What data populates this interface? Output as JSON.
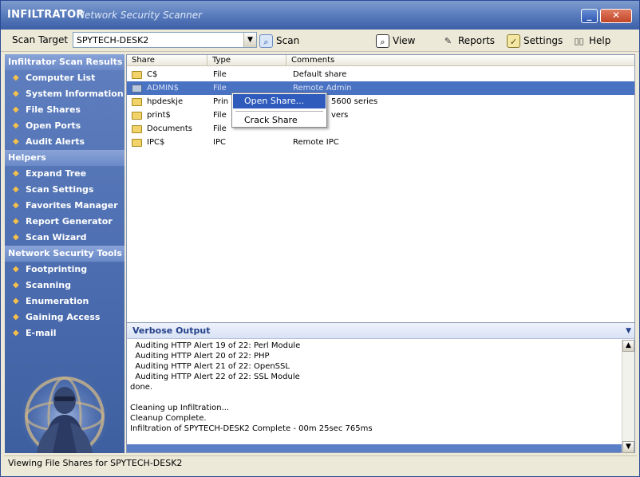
{
  "window": {
    "brand": "INFILTRATOR",
    "subtitle": "Network Security Scanner",
    "minimize_glyph": "_",
    "close_glyph": "✕"
  },
  "toolbar": {
    "scan_target_label": "Scan Target",
    "scan_target_value": "SPYTECH-DESK2",
    "scan_label": "Scan",
    "view_label": "View",
    "reports_label": "Reports",
    "settings_label": "Settings",
    "help_label": "Help"
  },
  "sidebar": {
    "sections": [
      {
        "title": "Infiltrator Scan Results",
        "items": [
          "Computer List",
          "System Information",
          "File Shares",
          "Open Ports",
          "Audit Alerts"
        ]
      },
      {
        "title": "Helpers",
        "items": [
          "Expand Tree",
          "Scan Settings",
          "Favorites Manager",
          "Report Generator",
          "Scan Wizard"
        ]
      },
      {
        "title": "Network Security Tools",
        "items": [
          "Footprinting",
          "Scanning",
          "Enumeration",
          "Gaining Access",
          "E-mail"
        ]
      }
    ]
  },
  "shares": {
    "columns": [
      "Share",
      "Type",
      "Comments"
    ],
    "rows": [
      {
        "share": "C$",
        "type": "File",
        "comment": "Default share",
        "shared_icon": false
      },
      {
        "share": "ADMIN$",
        "type": "File",
        "comment": "Remote Admin",
        "shared_icon": true
      },
      {
        "share": "hpdeskje",
        "type": "Prin",
        "comment": "5600 series",
        "shared_icon": false
      },
      {
        "share": "print$",
        "type": "File",
        "comment": "vers",
        "shared_icon": false
      },
      {
        "share": "Documents",
        "type": "File",
        "comment": "",
        "shared_icon": false
      },
      {
        "share": "IPC$",
        "type": "IPC",
        "comment": "Remote IPC",
        "shared_icon": false
      }
    ],
    "selected_index": 1
  },
  "context_menu": {
    "items": [
      "Open Share...",
      "Crack Share"
    ]
  },
  "verbose": {
    "title": "Verbose Output",
    "lines": [
      "  Auditing HTTP Alert 19 of 22: Perl Module",
      "  Auditing HTTP Alert 20 of 22: PHP",
      "  Auditing HTTP Alert 21 of 22: OpenSSL",
      "  Auditing HTTP Alert 22 of 22: SSL Module",
      "done.",
      "",
      "Cleaning up Infiltration...",
      "Cleanup Complete.",
      "Infiltration of SPYTECH-DESK2 Complete - 00m 25sec 765ms"
    ]
  },
  "status": {
    "text": "Viewing File Shares for SPYTECH-DESK2"
  }
}
